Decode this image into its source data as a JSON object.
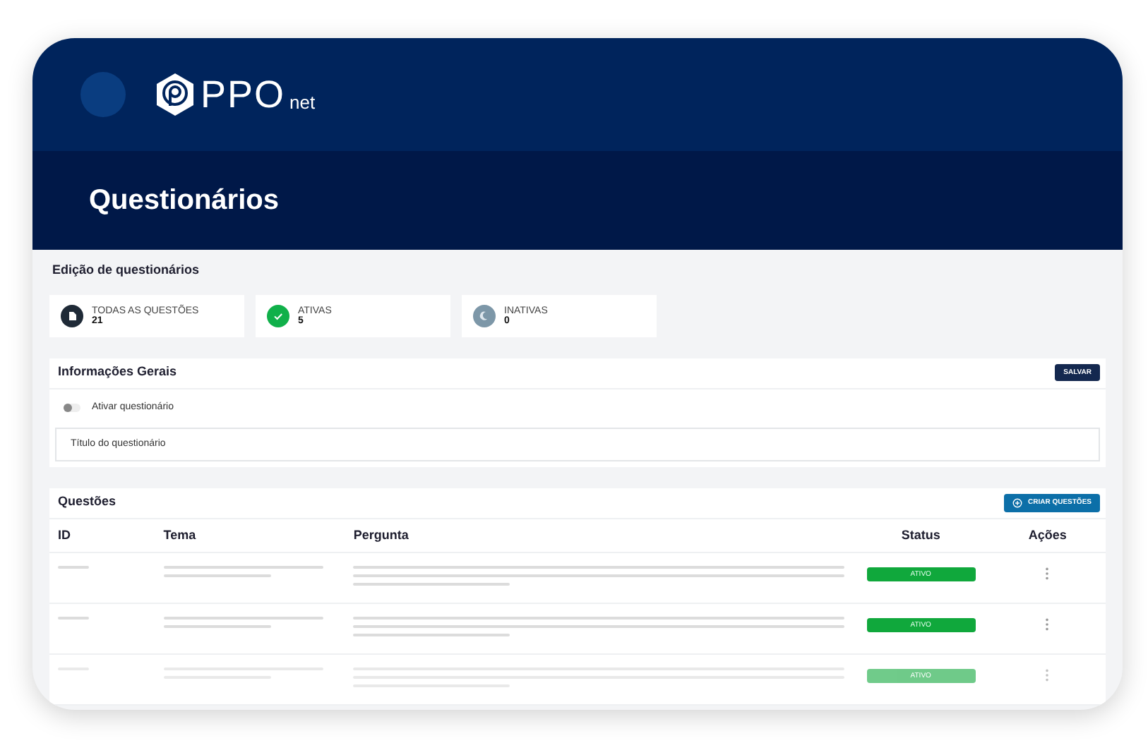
{
  "logo": {
    "main": "PPO",
    "suffix": "net"
  },
  "page_title": "Questionários",
  "section_title": "Edição de questionários",
  "stats": [
    {
      "kind": "all",
      "label": "TODAS AS QUESTÕES",
      "count": "21",
      "color": "#1f2a37"
    },
    {
      "kind": "active",
      "label": "ATIVAS",
      "count": "5",
      "color": "#10b04a"
    },
    {
      "kind": "inactive",
      "label": "INATIVAS",
      "count": "0",
      "color": "#7d97a8"
    }
  ],
  "general": {
    "title": "Informações Gerais",
    "save_button": "SALVAR",
    "toggle": {
      "label": "Ativar questionário",
      "on": false
    },
    "title_field": {
      "placeholder": "Título do questionário"
    }
  },
  "questions": {
    "title": "Questões",
    "create_button": "CRIAR QUESTÕES",
    "columns": [
      "ID",
      "Tema",
      "Pergunta",
      "Status",
      "Ações"
    ],
    "rows": [
      {
        "status": "ATIVO",
        "faded": false
      },
      {
        "status": "ATIVO",
        "faded": false
      },
      {
        "status": "ATIVO",
        "faded": true
      }
    ]
  }
}
